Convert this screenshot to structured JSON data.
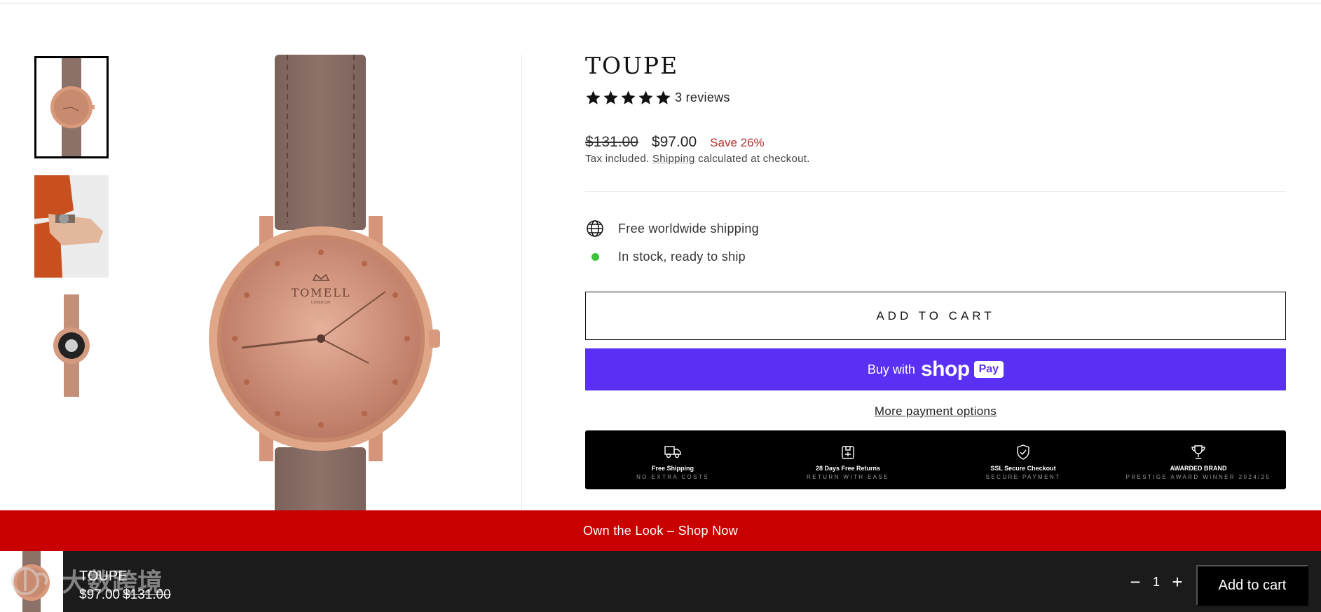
{
  "product": {
    "title": "TOUPE",
    "rating_stars": 5,
    "reviews": "3 reviews",
    "price_old": "$131.00",
    "price_new": "$97.00",
    "save": "Save 26%",
    "tax_prefix": "Tax included. ",
    "tax_link": "Shipping",
    "tax_suffix": " calculated at checkout."
  },
  "features": {
    "shipping": "Free worldwide shipping",
    "stock": "In stock, ready to ship"
  },
  "buttons": {
    "add_to_cart": "ADD TO CART",
    "buy_with": "Buy with",
    "shop_word": "shop",
    "pay_word": "Pay",
    "more_payment": "More payment options"
  },
  "trust": [
    {
      "title": "Free Shipping",
      "sub": "NO EXTRA COSTS",
      "icon": "truck-icon"
    },
    {
      "title": "28 Days Free Returns",
      "sub": "RETURN WITH EASE",
      "icon": "return-box-icon"
    },
    {
      "title": "SSL Secure Checkout",
      "sub": "SECURE PAYMENT",
      "icon": "shield-check-icon"
    },
    {
      "title": "AWARDED BRAND",
      "sub": "PRESTIGE AWARD WINNER 2024/25",
      "icon": "trophy-icon"
    }
  ],
  "watch_brand": "TOMELL",
  "watch_sub": "LONDON",
  "promo": "Own the Look – Shop Now",
  "sticky": {
    "title": "TOUPE",
    "price_new": "$97.00",
    "price_old": "$131.00",
    "qty": "1",
    "minus": "−",
    "plus": "+",
    "add": "Add to cart",
    "watermark": "大数跨境"
  },
  "colors": {
    "accent_purple": "#5a31f4",
    "promo_red": "#c80000",
    "save_red": "#b53131",
    "stock_green": "#3ec23a",
    "strap": "#8b7168",
    "case_rose": "#d99a7c"
  }
}
